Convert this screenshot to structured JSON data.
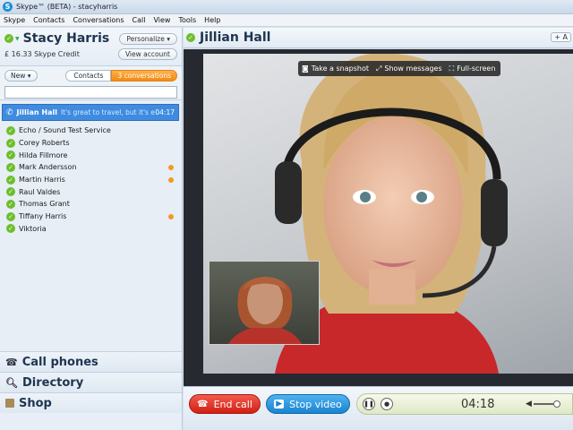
{
  "window": {
    "title": "Skype™ (BETA) - stacyharris",
    "app_icon": "S"
  },
  "menu": [
    "Skype",
    "Contacts",
    "Conversations",
    "Call",
    "View",
    "Tools",
    "Help"
  ],
  "profile": {
    "name": "Stacy Harris",
    "personalize_label": "Personalize ▾",
    "credit": "£ 16.33 Skype Credit",
    "view_account_label": "View account"
  },
  "tabs": {
    "new_label": "New ▾",
    "contacts_label": "Contacts",
    "conversations_label": "3 conversations"
  },
  "search": {
    "placeholder": ""
  },
  "active_conversation": {
    "name": "Jillian Hall",
    "message": "It's great to travel, but it's e...",
    "time": "04:17"
  },
  "contacts": [
    {
      "name": "Echo / Sound Test Service",
      "has_new": false
    },
    {
      "name": "Corey Roberts",
      "has_new": false
    },
    {
      "name": "Hilda Fillmore",
      "has_new": false
    },
    {
      "name": "Mark Andersson",
      "has_new": true
    },
    {
      "name": "Martin Harris",
      "has_new": true
    },
    {
      "name": "Raul Valdes",
      "has_new": false
    },
    {
      "name": "Thomas Grant",
      "has_new": false
    },
    {
      "name": "Tiffany Harris",
      "has_new": true
    },
    {
      "name": "Viktoria",
      "has_new": false
    }
  ],
  "bottom_links": {
    "call_phones": "Call phones",
    "directory": "Directory",
    "shop": "Shop"
  },
  "conversation": {
    "title": "Jillian Hall",
    "add_label": "+ A"
  },
  "video_overlay": {
    "snapshot_label": "Take a snapshot",
    "show_messages_label": "Show messages",
    "fullscreen_label": "Full-screen"
  },
  "call_toolbar": {
    "end_call_label": "End call",
    "stop_video_label": "Stop video",
    "timer": "04:18"
  },
  "colors": {
    "accent_blue": "#3f8be0",
    "online_green": "#6cbf2a",
    "unread_orange": "#f39a1e",
    "end_call_red": "#d11f12"
  }
}
